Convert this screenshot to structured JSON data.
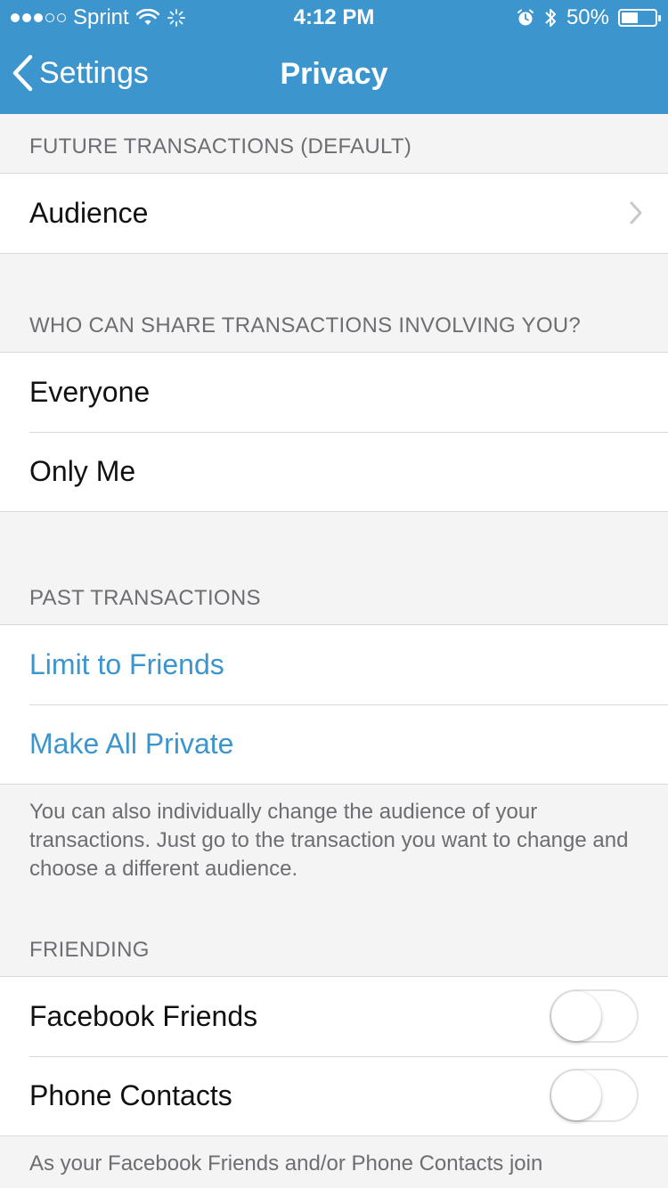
{
  "status_bar": {
    "carrier": "Sprint",
    "time": "4:12 PM",
    "battery": "50%",
    "battery_level": 0.5,
    "signal_bars": 3,
    "signal_total": 5,
    "icons": [
      "signal-dots-icon",
      "wifi-icon",
      "activity-spinner-icon",
      "alarm-icon",
      "bluetooth-icon",
      "battery-icon"
    ]
  },
  "nav": {
    "back_label": "Settings",
    "title": "Privacy"
  },
  "sections": {
    "future": {
      "header": "FUTURE TRANSACTIONS (DEFAULT)",
      "rows": [
        {
          "label": "Audience"
        }
      ]
    },
    "share": {
      "header": "WHO CAN SHARE TRANSACTIONS INVOLVING YOU?",
      "rows": [
        {
          "label": "Everyone"
        },
        {
          "label": "Only Me"
        }
      ]
    },
    "past": {
      "header": "PAST TRANSACTIONS",
      "rows": [
        {
          "label": "Limit to Friends"
        },
        {
          "label": "Make All Private"
        }
      ],
      "footnote": "You can also individually change the audience of your transactions. Just go to the transaction you want to change and choose a different audience."
    },
    "friending": {
      "header": "FRIENDING",
      "rows": [
        {
          "label": "Facebook Friends",
          "enabled": false
        },
        {
          "label": "Phone Contacts",
          "enabled": false
        }
      ],
      "footnote": "As your Facebook Friends and/or Phone Contacts join"
    }
  },
  "colors": {
    "accent": "#3d95ce",
    "background": "#f4f4f5",
    "header_text": "#6d6d72"
  }
}
